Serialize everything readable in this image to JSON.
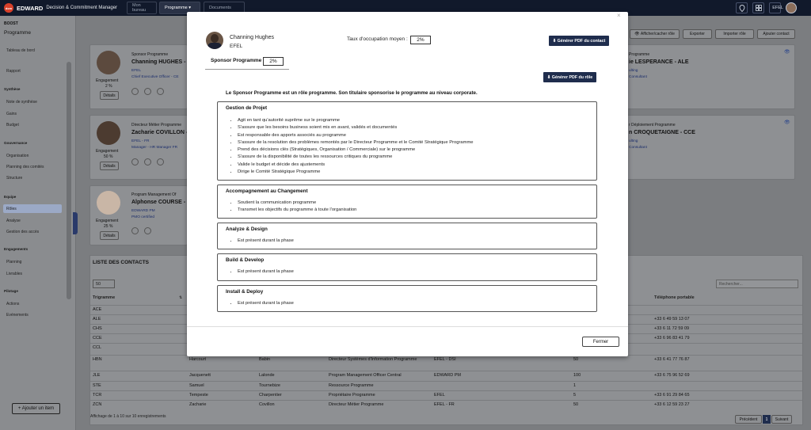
{
  "topbar": {
    "logo_text": "dcm",
    "app_name": "EDWARD",
    "app_subtitle": "Decision & Commitment Manager",
    "nav": [
      "Mon bureau",
      "Programme",
      "Documents"
    ],
    "nav_chevron": "▾",
    "user": "EFEL"
  },
  "sidebar": {
    "org": "BOOST",
    "scope": "Programme",
    "dashboard": "Tableau de bord",
    "report": "Rapport",
    "sections": [
      {
        "title": "Synthèse",
        "items": [
          "Note de synthèse",
          "Gains",
          "Budget"
        ]
      },
      {
        "title": "Gouvernance",
        "items": [
          "Organisation",
          "Planning des comités",
          "Structure"
        ]
      },
      {
        "title": "Equipe",
        "items": [
          "Rôles",
          "Analyse",
          "Gestion des accès"
        ]
      },
      {
        "title": "Engagements",
        "items": [
          "Planning",
          "Livrables"
        ]
      },
      {
        "title": "Pilotage",
        "items": [
          "Actions",
          "Evénements"
        ]
      }
    ],
    "add_item": "+ Ajouter un item"
  },
  "toolbar": {
    "show_hide": "Afficher/cacher rôle",
    "export": "Exporter",
    "import": "Importer rôle",
    "add_contact": "Ajouter contact"
  },
  "cards": [
    {
      "role": "Sponsor Programme",
      "name": "Channing HUGHES - C",
      "org": "EFEL",
      "title": "Chief Executive Officer - CE",
      "engagement_label": "Engagement",
      "engagement": "2 %",
      "details": "Détails"
    },
    {
      "role": "Directeur Métier Programme",
      "name": "Zacharie COVILLON -",
      "org": "EFEL - FR",
      "title": "Manager - HR Manager FR",
      "engagement_label": "Engagement",
      "engagement": "50 %",
      "details": "Détails"
    },
    {
      "role": "Program Management Of",
      "name": "Alphonse COURSE - A",
      "org": "EDWARD PM",
      "title": "PMO certified",
      "engagement_label": "Engagement",
      "engagement": "25 %",
      "details": "Détails"
    }
  ],
  "right_cards": [
    {
      "role": "Programme",
      "name": "ie LESPERANCE - ALE",
      "line1": "ulting",
      "line2": "Consultant"
    },
    {
      "role": "r Déploiement Programme",
      "name": "n CROQUETAIGNE - CCE",
      "line1": "ulting",
      "line2": "Consultant"
    }
  ],
  "contacts": {
    "title": "LISTE DES CONTACTS",
    "page_size": "50",
    "search_placeholder": "Rechercher...",
    "headers": [
      "Trigramme",
      "Téléphone portable"
    ],
    "rows": [
      [
        "ACE",
        "",
        "",
        "",
        "",
        "",
        ""
      ],
      [
        "ALE",
        "",
        "",
        "",
        "",
        "",
        "+33 6 49 59 13 07"
      ],
      [
        "CHS",
        "",
        "",
        "",
        "",
        "",
        "+33 6 11 72 59 09"
      ],
      [
        "CCE",
        "",
        "",
        "",
        "",
        "",
        "+33 6 96 83 41 79"
      ],
      [
        "CCL",
        "",
        "",
        "",
        "",
        "",
        ""
      ],
      [
        "HBN",
        "Harcourt",
        "Babin",
        "Directeur Systèmes d'Information Programme",
        "EFEL - DSI",
        "50",
        "+33 6 41 77 76 87"
      ],
      [
        "JLE",
        "Jacquenett",
        "Lalonde",
        "Program Management Officer Central",
        "EDWARD PM",
        "100",
        "+33 6 75 96 52 69"
      ],
      [
        "STE",
        "Samuel",
        "Tournebize",
        "Ressource Programme",
        "",
        "1",
        ""
      ],
      [
        "TCR",
        "Tempeste",
        "Charpentier",
        "Propriétaire Programme",
        "EFEL",
        "5",
        "+33 6 91 29 84 65"
      ],
      [
        "ZCN",
        "Zacharie",
        "Covillon",
        "Directeur Métier Programme",
        "EFEL - FR",
        "50",
        "+33 6 12 59 23 27"
      ]
    ],
    "footer": "Affichage de 1 à 10 sur 10 enregistrements",
    "prev": "Précédent",
    "page": "1",
    "next": "Suivant"
  },
  "modal": {
    "close_glyph": "×",
    "name": "Channing Hughes",
    "org": "EFEL",
    "occupation_label": "Taux d'occupation moyen :",
    "occupation_value": "2%",
    "pdf_contact": "Générer PDF du contact",
    "tab_label": "Sponsor Programme",
    "tab_value": "2%",
    "pdf_role": "Générer PDF du rôle",
    "intro": "Le Sponsor Programme est un rôle programme. Son titulaire sponsorise le programme au niveau corporate.",
    "sections": [
      {
        "title": "Gestion de Projet",
        "items": [
          "Agit en tant qu'autorité suprême sur le programme",
          "S'assure que les besoins business soient mis en avant, validés et documentés",
          "Est responsable des apports associés au programme",
          "S'assure de la resolution des problèmes remontés par le Directeur Programme et le Comité Stratégique Programme",
          "Prend des décisions clés (Stratégiques, Organisation / Commerciale) sur le programme",
          "S'assure de la disponibilité de toutes les ressources critiques du programme",
          "Valide le budget et décide des ajustements",
          "Dirige le Comité Stratégique Programme"
        ]
      },
      {
        "title": "Accompagnement au Changement",
        "items": [
          "Soutient la communication programme",
          "Transmet les objectifs du programme à toute l'organisation"
        ]
      },
      {
        "title": "Analyze & Design",
        "items": [
          "Est présent durant la phase"
        ]
      },
      {
        "title": "Build & Develop",
        "items": [
          "Est présent durant la phase"
        ]
      },
      {
        "title": "Install & Deploy",
        "items": [
          "Est présent durant la phase"
        ]
      }
    ],
    "close_button": "Fermer"
  }
}
